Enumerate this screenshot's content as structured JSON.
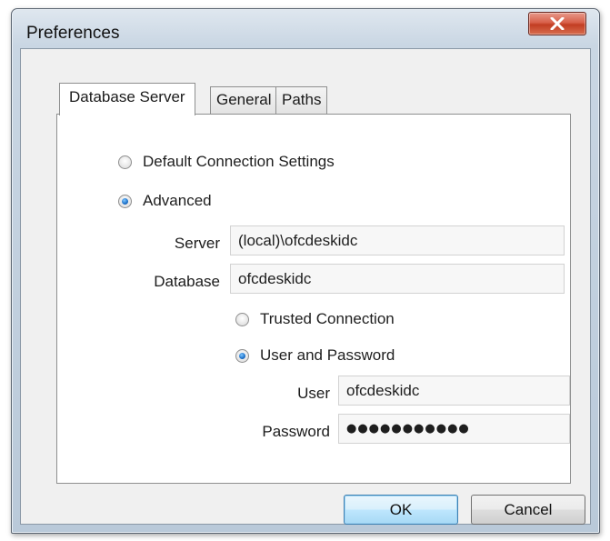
{
  "window": {
    "title": "Preferences",
    "close_glyph": "X"
  },
  "tabs": [
    {
      "label": "Database Server",
      "active": true
    },
    {
      "label": "General",
      "active": false
    },
    {
      "label": "Paths",
      "active": false
    }
  ],
  "connection": {
    "default_label": "Default Connection Settings",
    "default_selected": false,
    "advanced_label": "Advanced",
    "advanced_selected": true
  },
  "server": {
    "label": "Server",
    "value": "(local)\\ofcdeskidc"
  },
  "database": {
    "label": "Database",
    "value": "ofcdeskidc"
  },
  "auth": {
    "trusted_label": "Trusted Connection",
    "trusted_selected": false,
    "userpass_label": "User and Password",
    "userpass_selected": true
  },
  "user": {
    "label": "User",
    "value": "ofcdeskidc"
  },
  "password": {
    "label": "Password",
    "masked_value": "●●●●●●●●●●●"
  },
  "buttons": {
    "ok": "OK",
    "cancel": "Cancel"
  },
  "colors": {
    "close_button": "#c8442a",
    "radio_selected": "#1b6fc8",
    "default_button_border": "#3c7fb1"
  }
}
